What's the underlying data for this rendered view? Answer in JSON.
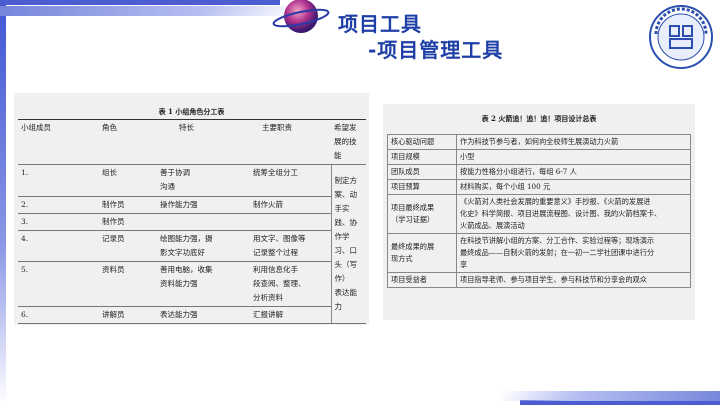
{
  "header": {
    "title_line1": "项目工具",
    "title_line2": "-项目管理工具"
  },
  "logo": {
    "alt": "school-emblem"
  },
  "table1": {
    "caption": "表 1 小组角色分工表",
    "headers": [
      "小组成员",
      "角色",
      "特长",
      "主要职责",
      "希望发展的技能"
    ],
    "rows": [
      {
        "no": "1.",
        "role": "组长",
        "skill": "善于协调\n沟通",
        "duty": "统筹全组分工"
      },
      {
        "no": "2.",
        "role": "制作员",
        "skill": "操作能力强",
        "duty": "制作火箭"
      },
      {
        "no": "3.",
        "role": "制作员",
        "skill": "",
        "duty": ""
      },
      {
        "no": "4.",
        "role": "记录员",
        "skill": "绘图能力强，摄\n影文字功底好",
        "duty": "用文字、图像等\n记录整个过程"
      },
      {
        "no": "5.",
        "role": "资料员",
        "skill": "善用电脑，收集\n资料能力强",
        "duty": "利用信息化手\n段查阅、整理、\n分析资料"
      },
      {
        "no": "6.",
        "role": "讲解员",
        "skill": "表达能力强",
        "duty": "汇报讲解"
      }
    ],
    "hope": "制定方案、动手实\n践、协作学\n习、口头（写作）\n表达能力"
  },
  "table2": {
    "caption": "表 2 火箭追！追！追！项目设计总表",
    "rows": [
      {
        "label": "核心驱动问题",
        "value": "作为科技节参与者，如何向全校师生展演动力火箭"
      },
      {
        "label": "项目规模",
        "value": "小型"
      },
      {
        "label": "团队成员",
        "value": "按能力性格分小组进行，每组 6-7 人"
      },
      {
        "label": "项目预算",
        "value": "材料购买，每个小组 100 元"
      },
      {
        "label": "项目最终成果\n（学习证据）",
        "value": "《火箭对人类社会发展的重要意义》手抄报、《火箭的发展进\n化史》科学简报、项目进展流程图、设计图、我的火箭档案卡、\n火箭成品、展演活动"
      },
      {
        "label": "最终成果的展\n现方式",
        "value": "在科技节讲解小组的方案、分工合作、实验过程等；现场演示\n最终成品——自制火箭的发射；在一初一二学社团课中进行分\n享"
      },
      {
        "label": "项目受益者",
        "value": "项目指导老师、参与项目学生、参与科技节和分享会的观众"
      }
    ]
  },
  "colors": {
    "title": "#1f3fa8",
    "accent": "#4b5dd0",
    "panel": "#eef0f2"
  }
}
